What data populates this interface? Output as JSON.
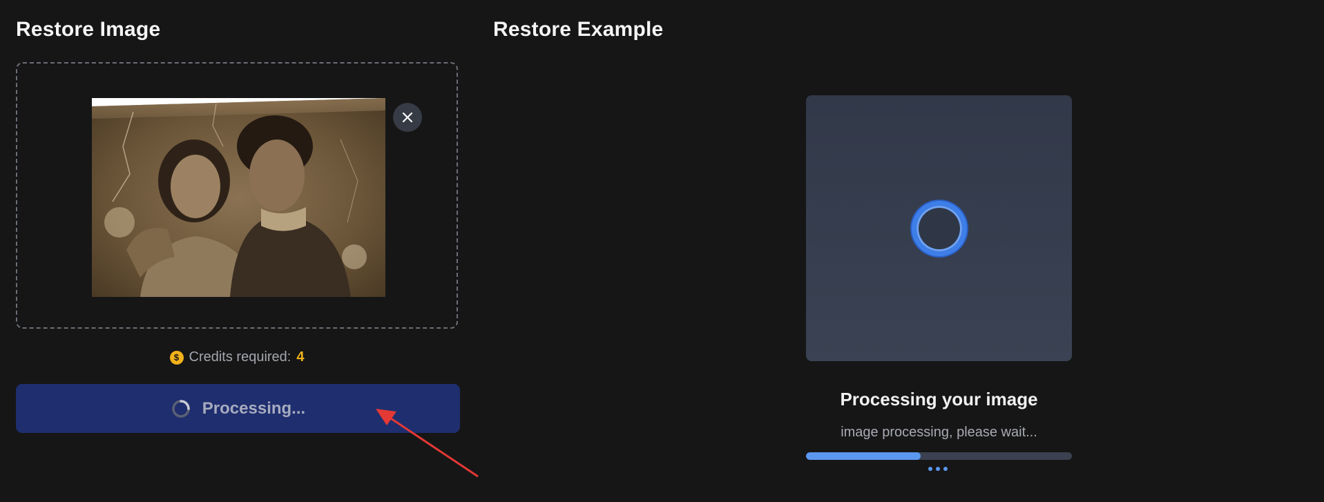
{
  "left_panel": {
    "title": "Restore Image",
    "credits": {
      "label": "Credits required:",
      "value": "4",
      "icon": "coin-dollar-icon"
    },
    "process_button": {
      "label": "Processing...",
      "icon": "spinner-icon"
    },
    "remove_icon": "close-icon"
  },
  "right_panel": {
    "title": "Restore Example",
    "status_title": "Processing your image",
    "status_subtitle": "image processing, please wait...",
    "progress": 0.43
  },
  "colors": {
    "background": "#161616",
    "accent_blue": "#5b97ef",
    "button_bg": "#1f2e6e",
    "credit_gold": "#f2b21b",
    "annotation_arrow": "#e53935"
  }
}
